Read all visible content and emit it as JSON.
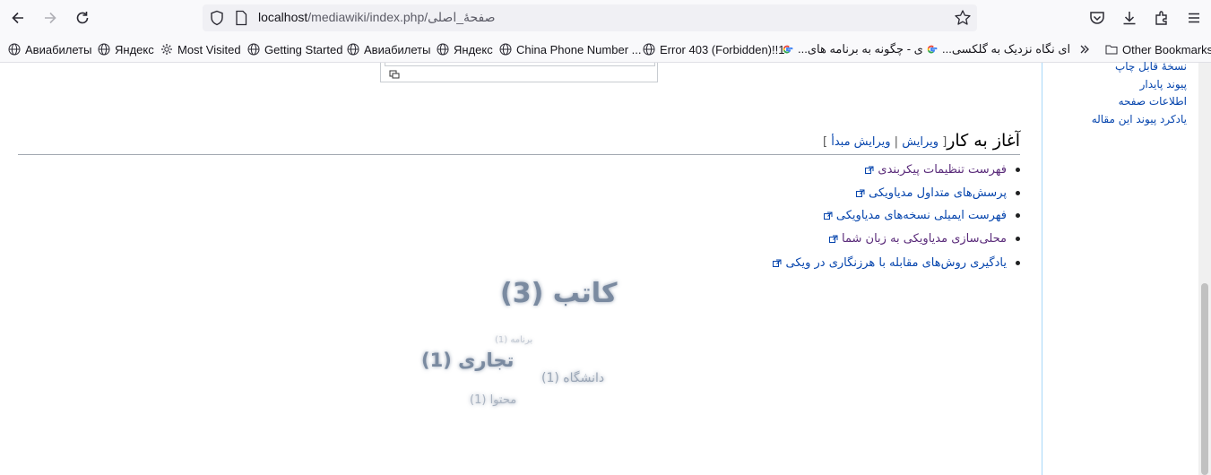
{
  "browser": {
    "url_host": "localhost",
    "url_path": "/mediawiki/index.php/صفحهٔ_اصلی"
  },
  "bookmarks": [
    {
      "label": "Авиабилеты",
      "icon": "globe-icon"
    },
    {
      "label": "Яндекс",
      "icon": "globe-icon"
    },
    {
      "label": "Most Visited",
      "icon": "gear-icon"
    },
    {
      "label": "Getting Started",
      "icon": "globe-icon"
    },
    {
      "label": "Авиабилеты",
      "icon": "globe-icon"
    },
    {
      "label": "Яндекс",
      "icon": "globe-icon"
    },
    {
      "label": "China Phone Number ...",
      "icon": "globe-icon"
    },
    {
      "label": "Error 403 (Forbidden)!!1",
      "icon": "globe-icon"
    },
    {
      "label": "...ی - چگونه به برنامه های",
      "icon": "google-icon"
    },
    {
      "label": "...ای نگاه نزدیک به گلکسی",
      "icon": "google-icon"
    }
  ],
  "other_bookmarks": "Other Bookmarks",
  "sidebar": {
    "links": [
      "نسخهٔ قابل چاپ",
      "پیوند پایدار",
      "اطلاعات صفحه",
      "یادکرد پیوند این مقاله"
    ]
  },
  "section": {
    "heading": "آغاز به کار",
    "edit_open": "[ ",
    "edit": "ویرایش",
    "sep": " | ",
    "edit_source": "ویرایش مبدأ",
    "edit_close": " ]"
  },
  "list": [
    "فهرست تنظیمات پیکربندی",
    "پرسش‌های متداول مدیاویکی",
    "فهرست ایمیلی نسخه‌های مدیاویکی",
    "محلی‌سازی مدیاویکی به زبان شما",
    "یادگیری روش‌های مقابله با هرزنگاری در ویکی"
  ],
  "tag_cloud": [
    {
      "label": "کاتب (3)"
    },
    {
      "label": "برنامه (1)"
    },
    {
      "label": "تجاری (1)"
    },
    {
      "label": "دانشگاه (1)"
    },
    {
      "label": "محتوا (1)"
    }
  ],
  "colors": {
    "link": "#0645ad",
    "visited": "#5a2b7a"
  }
}
